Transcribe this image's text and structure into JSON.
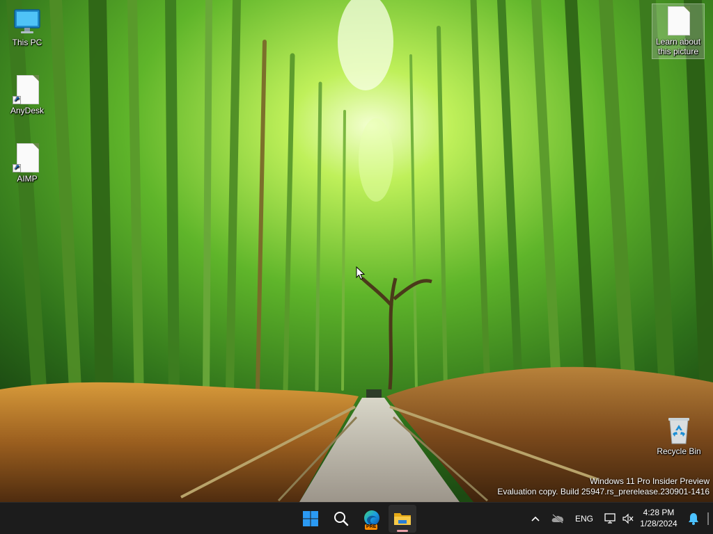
{
  "desktop": {
    "icons": [
      {
        "label": "This PC"
      },
      {
        "label": "AnyDesk"
      },
      {
        "label": "AIMP"
      },
      {
        "label": "Learn about this picture"
      },
      {
        "label": "Recycle Bin"
      }
    ]
  },
  "watermark": {
    "line1": "Windows 11 Pro Insider Preview",
    "line2": "Evaluation copy. Build 25947.rs_prerelease.230901-1416"
  },
  "taskbar": {
    "apps": [
      {
        "icon": "windows-start-icon"
      },
      {
        "icon": "search-icon"
      },
      {
        "icon": "edge-preview-icon",
        "badge": "PRE"
      },
      {
        "icon": "file-explorer-icon"
      }
    ],
    "tray": {
      "language": "ENG",
      "time": "4:28 PM",
      "date": "1/28/2024"
    }
  },
  "colors": {
    "taskbar_bg": "#1c1c1c",
    "accent": "#0078d4",
    "start_blue": "#2b9af3",
    "explorer_yellow": "#f7c948"
  }
}
